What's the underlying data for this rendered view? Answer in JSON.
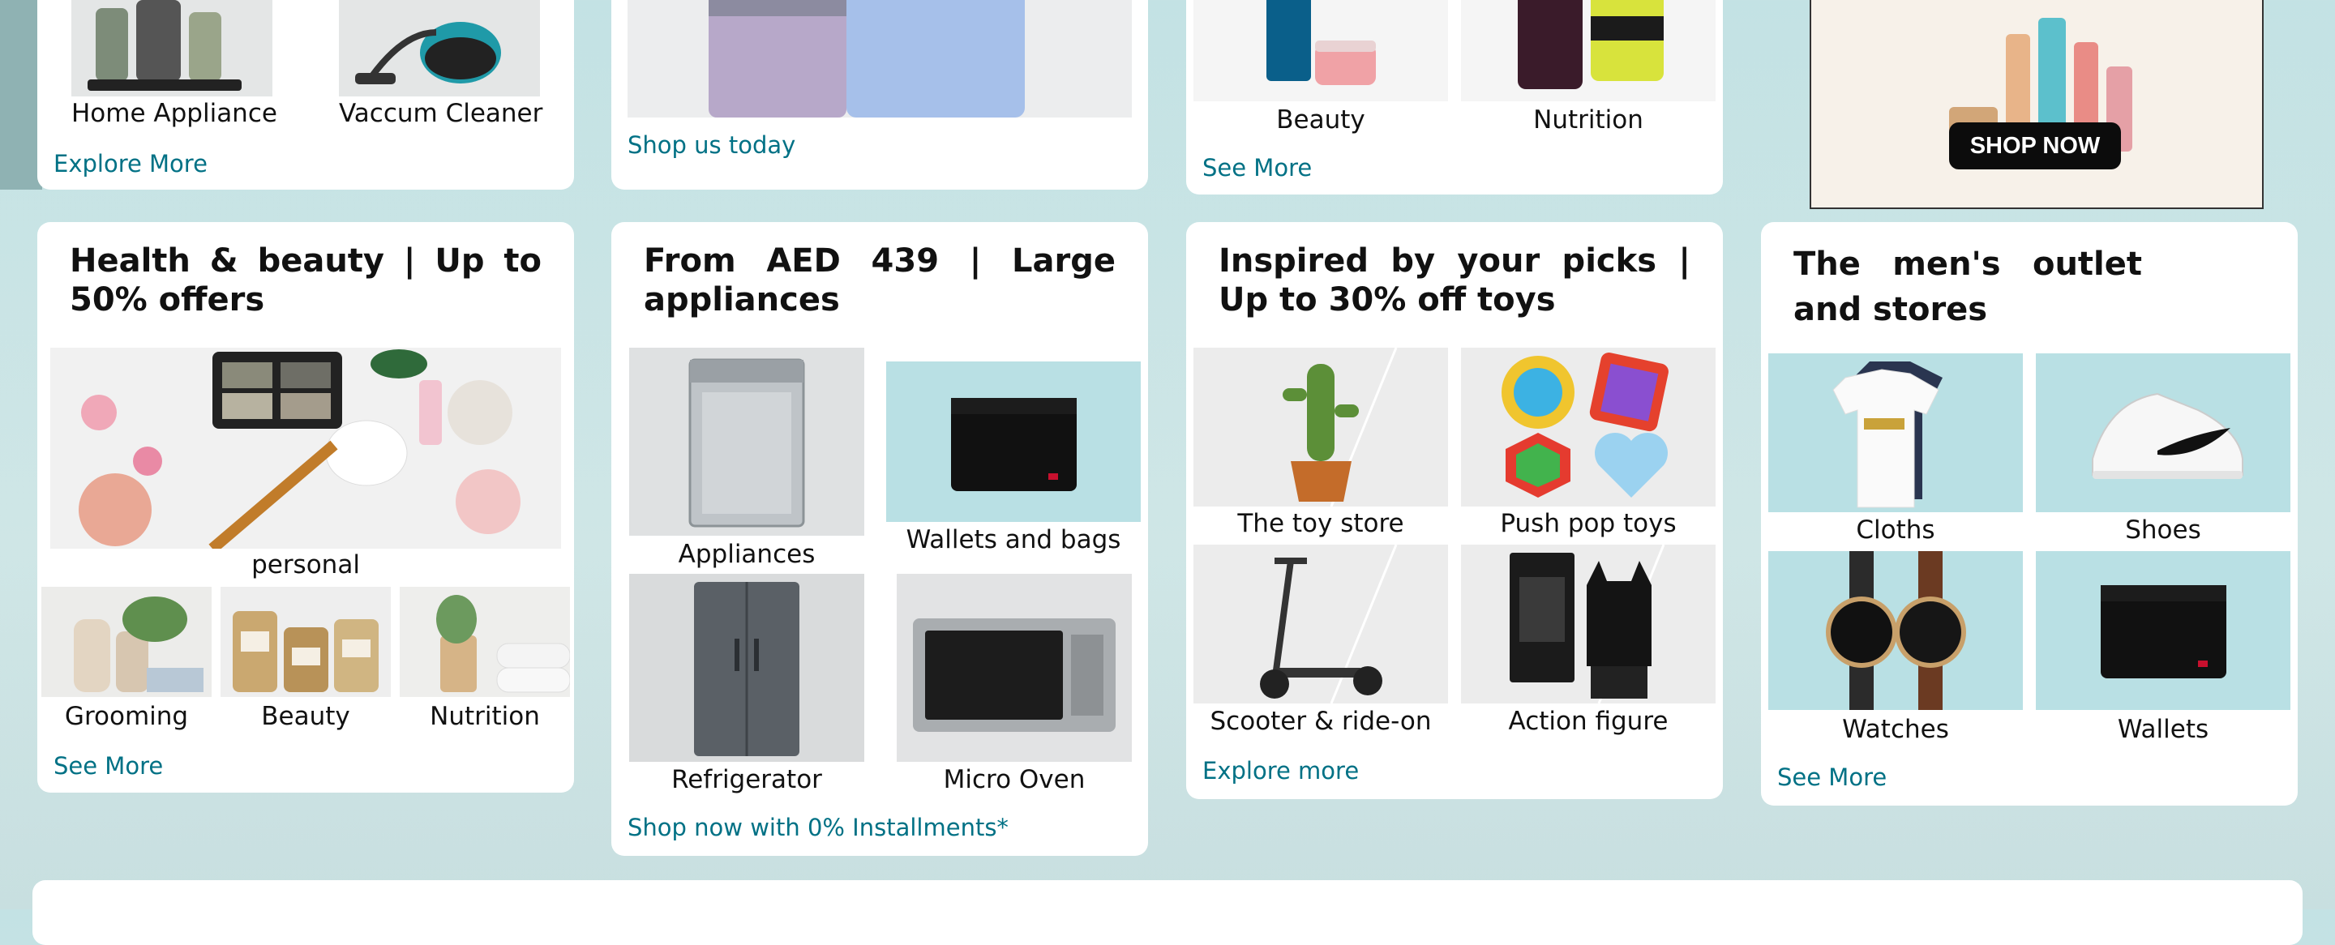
{
  "top_row": {
    "appliance_card": {
      "items": [
        {
          "label": "Home Appliance",
          "icon": "blender-icon"
        },
        {
          "label": "Vaccum Cleaner",
          "icon": "vacuum-icon"
        }
      ],
      "link": "Explore More"
    },
    "phone_card": {
      "link": "Shop us today"
    },
    "beauty_card": {
      "items": [
        {
          "label": "Beauty",
          "icon": "cosmetics-icon"
        },
        {
          "label": "Nutrition",
          "icon": "supplements-icon"
        }
      ],
      "link": "See More"
    },
    "ad_card": {
      "button": "SHOP NOW"
    }
  },
  "health_beauty": {
    "title": "Health & beauty | Up to 50% offers",
    "main_label": "personal",
    "items": [
      {
        "label": "Grooming"
      },
      {
        "label": "Beauty"
      },
      {
        "label": "Nutrition"
      }
    ],
    "link": "See More"
  },
  "appliances": {
    "title": "From AED 439 | Large appliances",
    "items": [
      {
        "label": "Appliances"
      },
      {
        "label": "Wallets and bags"
      },
      {
        "label": "Refrigerator"
      },
      {
        "label": "Micro Oven"
      }
    ],
    "link": "Shop now with 0% Installments*"
  },
  "toys": {
    "title": "Inspired by your picks | Up to 30% off toys",
    "items": [
      {
        "label": "The toy store"
      },
      {
        "label": "Push pop toys"
      },
      {
        "label": "Scooter & ride-on"
      },
      {
        "label": "Action figure"
      }
    ],
    "link": "Explore more"
  },
  "mens": {
    "title": "The men's outlet and stores",
    "items": [
      {
        "label": "Cloths"
      },
      {
        "label": "Shoes"
      },
      {
        "label": "Watches"
      },
      {
        "label": "Wallets"
      }
    ],
    "link": "See More"
  },
  "colors": {
    "link": "#007185",
    "tile_bg": "#b9e0e4",
    "page_bg": "#c3e2e4"
  }
}
